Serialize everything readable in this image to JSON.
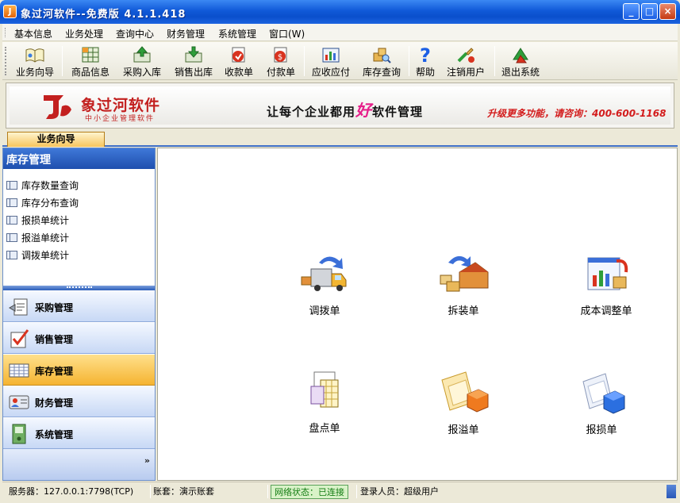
{
  "window": {
    "title": "象过河软件--免费版   4.1.1.418"
  },
  "menu": [
    {
      "label": "基本信息"
    },
    {
      "label": "业务处理"
    },
    {
      "label": "查询中心"
    },
    {
      "label": "财务管理"
    },
    {
      "label": "系统管理"
    },
    {
      "label": "窗口(W)"
    }
  ],
  "toolbar": [
    {
      "label": "业务向导",
      "icon": "book-icon"
    },
    {
      "label": "商品信息",
      "icon": "grid-icon"
    },
    {
      "label": "采购入库",
      "icon": "inbox-up-icon"
    },
    {
      "label": "销售出库",
      "icon": "inbox-down-icon"
    },
    {
      "label": "收款单",
      "icon": "receipt-in-icon"
    },
    {
      "label": "付款单",
      "icon": "receipt-out-icon"
    },
    {
      "label": "应收应付",
      "icon": "chart-icon"
    },
    {
      "label": "库存查询",
      "icon": "stock-query-icon"
    },
    {
      "label": "帮助",
      "icon": "help-icon"
    },
    {
      "label": "注销用户",
      "icon": "logout-user-icon"
    },
    {
      "label": "退出系统",
      "icon": "exit-icon"
    }
  ],
  "banner": {
    "logo_name": "象过河软件",
    "logo_sub": "中小企业管理软件",
    "slogan_pre": "让每个企业都用",
    "slogan_hi": "好",
    "slogan_post": "软件管理",
    "hotline": "升级更多功能，请咨询：400-600-1168"
  },
  "tab": {
    "label": "业务向导"
  },
  "left_panel": {
    "title": "库存管理",
    "items": [
      {
        "label": "库存数量查询"
      },
      {
        "label": "库存分布查询"
      },
      {
        "label": "报损单统计"
      },
      {
        "label": "报溢单统计"
      },
      {
        "label": "调拨单统计"
      }
    ],
    "nav": [
      {
        "label": "采购管理",
        "active": false
      },
      {
        "label": "销售管理",
        "active": false
      },
      {
        "label": "库存管理",
        "active": true
      },
      {
        "label": "财务管理",
        "active": false
      },
      {
        "label": "系统管理",
        "active": false
      }
    ],
    "more": "»"
  },
  "functions": [
    {
      "label": "调拨单"
    },
    {
      "label": "拆装单"
    },
    {
      "label": "成本调整单"
    },
    {
      "label": "盘点单"
    },
    {
      "label": "报溢单"
    },
    {
      "label": "报损单"
    }
  ],
  "status": {
    "server": "服务器：127.0.0.1:7798(TCP)",
    "account": "账套：演示账套",
    "network": "网络状态：已连接",
    "user": "登录人员：超级用户"
  },
  "colors": {
    "titlebar": "#0a4fcc",
    "accent_orange": "#f5b431",
    "brand_red": "#c3201f",
    "network_ok": "#137c13"
  }
}
